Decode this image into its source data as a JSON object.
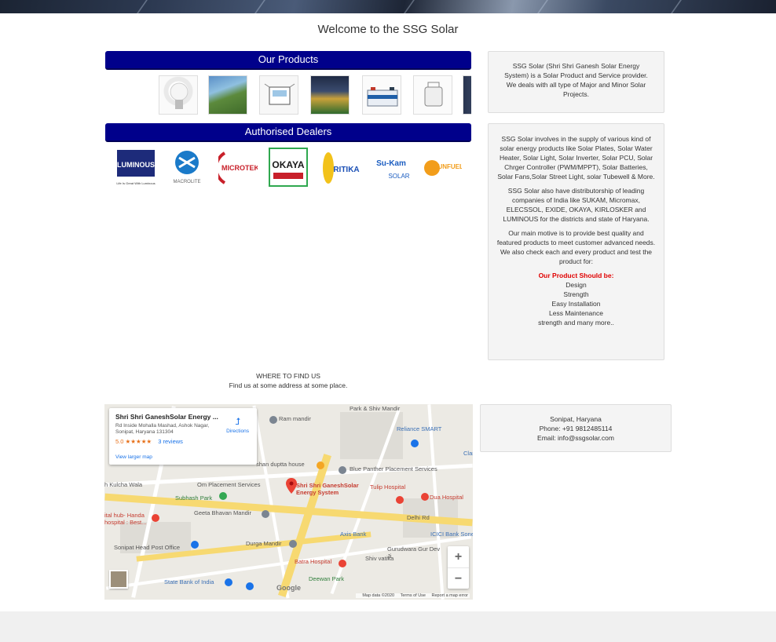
{
  "site": {
    "title": "Welcome to the SSG Solar"
  },
  "products": {
    "heading": "Our Products",
    "items": [
      "LED Bulb",
      "Solar Water Heater",
      "Solar Inverter",
      "Solar Street Light",
      "Solar Batteries",
      "Solar Lantern",
      "Solar Panel"
    ]
  },
  "dealers": {
    "heading": "Authorised Dealers",
    "logos": [
      {
        "name": "LUMINOUS",
        "color": "#1d2b7a"
      },
      {
        "name": "MACROLITE",
        "color": "#1a7ac9"
      },
      {
        "name": "MICROTEK",
        "color": "#c8202a"
      },
      {
        "name": "OKAYA",
        "color": "#1a1a1a"
      },
      {
        "name": "RITIKA",
        "color": "#1a4fb5"
      },
      {
        "name": "Su-Kam SOLAR",
        "color": "#1a5cc0"
      },
      {
        "name": "SUNFUEL",
        "color": "#f29d1a"
      }
    ]
  },
  "about": {
    "text": "SSG Solar (Shri Shri Ganesh Solar Energy System) is a Solar Product and Service provider. We deals with all type of Major and Minor Solar Projects."
  },
  "details": {
    "para1": "SSG Solar involves in the supply of various kind of solar energy products like Solar Plates, Solar Water Heater, Solar Light, Solar Inverter, Solar PCU, Solar Chrger Controller (PWM/MPPT), Solar Batteries, Solar Fans,Solar Street Light, solar Tubewell & More.",
    "para2": "SSG Solar also have distributorship of leading companies of India like SUKAM, Micromax, ELECSSOL, EXIDE, OKAYA, KIRLOSKER and LUMINOUS for the districts and state of Haryana.",
    "para3a": "Our main motive is to provide best quality and featured products to meet customer advanced needs.",
    "para3b": "We also check each and every product and test the product for:",
    "should_be_heading": "Our Product Should be:",
    "qualities": [
      "Design",
      "Strength",
      "Easy Installation",
      "Less Maintenance",
      "strength and many more.."
    ]
  },
  "find_us": {
    "heading": "WHERE TO FIND US",
    "text": "Find us at some address at some place."
  },
  "map": {
    "place_name": "Shri Shri GaneshSolar Energy ...",
    "address": "Rd Inside Mohalla Mashad, Ashok Nagar, Sonipat, Haryana 131304",
    "rating": "5.0",
    "stars": "★★★★★",
    "reviews": "3 reviews",
    "directions": "Directions",
    "view_larger": "View larger map",
    "google": "Google",
    "map_data": "Map data ©2020",
    "terms": "Terms of Use",
    "report": "Report a map error",
    "labels": {
      "park_shiv": "Park & Shiv Mandir",
      "ram_mandir": "Ram mandir",
      "reliance": "Reliance SMART",
      "duptta": "shan duptta house",
      "blue_panther": "Blue Panther Placement Services",
      "kulcha": "h Kulcha Wala",
      "om_placement": "Om Placement Services",
      "subhash_park": "Subhash Park",
      "pin_label": "Shri Shri GaneshSolar Energy System",
      "tulip": "Tulip Hospital",
      "dua": "Dua Hospital",
      "geeta": "Geeta Bhavan Mandir",
      "delhi_rd": "Delhi Rd",
      "handa": "ital hub- Handa hospital : Best...",
      "axis": "Axis Bank",
      "icici": "ICICI Bank Sonepa",
      "durga": "Durga Mandir",
      "post_office": "Sonipat Head Post Office",
      "gurudwara": "Gurudwara Gur Dev Ji",
      "batra": "Batra Hospital",
      "shiv_vatika": "Shiv vatika",
      "sbi": "State Bank of India",
      "deewan": "Deewan Park",
      "clas": "Clas"
    }
  },
  "contact": {
    "city": "Sonipat, Haryana",
    "phone": "Phone: +91 9812485114",
    "email": "Email: info@ssgsolar.com"
  }
}
